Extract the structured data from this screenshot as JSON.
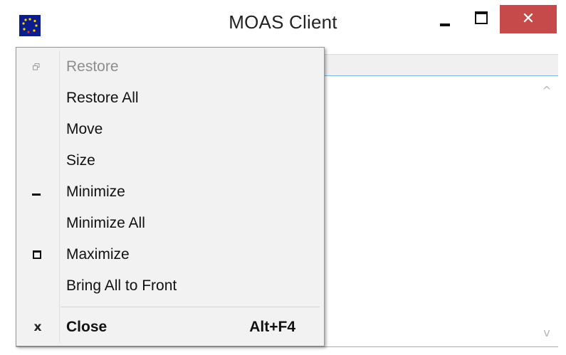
{
  "window": {
    "title": "MOAS Client",
    "close_glyph": "✕",
    "app_icon": "eu-flag-icon"
  },
  "system_menu": {
    "items": [
      {
        "label": "Restore",
        "icon": "restore-icon",
        "enabled": false
      },
      {
        "label": "Restore All",
        "icon": "",
        "enabled": true
      },
      {
        "label": "Move",
        "icon": "",
        "enabled": true
      },
      {
        "label": "Size",
        "icon": "",
        "enabled": true
      },
      {
        "label": "Minimize",
        "icon": "minimize-icon",
        "enabled": true
      },
      {
        "label": "Minimize All",
        "icon": "",
        "enabled": true
      },
      {
        "label": "Maximize",
        "icon": "maximize-icon",
        "enabled": true
      },
      {
        "label": "Bring All to Front",
        "icon": "",
        "enabled": true
      }
    ],
    "close": {
      "label": "Close",
      "icon_glyph": "x",
      "accelerator": "Alt+F4"
    }
  },
  "scrollbar": {
    "up_glyph": "^",
    "down_glyph": "v"
  },
  "colors": {
    "close_button": "#c74a4a",
    "client_border": "#7fb4e6",
    "menu_background": "#f2f2f2"
  }
}
